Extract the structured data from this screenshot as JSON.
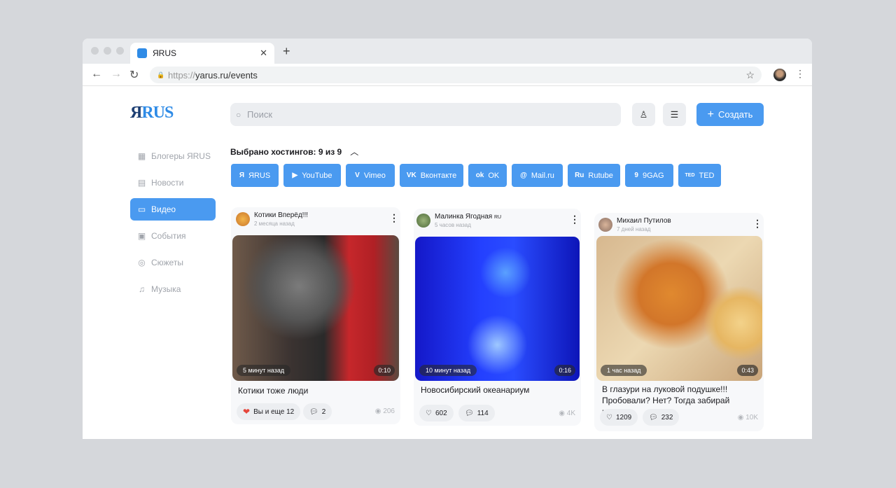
{
  "browser": {
    "tab_title": "ЯRUS",
    "url_scheme": "https://",
    "url_rest": "yarus.ru/events"
  },
  "logo": {
    "part1": "Я",
    "part2": "RUS"
  },
  "search": {
    "placeholder": "Поиск"
  },
  "header": {
    "create_label": "Создать"
  },
  "sidebar": {
    "items": [
      {
        "label": "Блогеры ЯRUS",
        "icon": "grid-icon"
      },
      {
        "label": "Новости",
        "icon": "news-icon"
      },
      {
        "label": "Видео",
        "icon": "video-icon",
        "active": true
      },
      {
        "label": "События",
        "icon": "calendar-icon"
      },
      {
        "label": "Сюжеты",
        "icon": "play-circle-icon"
      },
      {
        "label": "Музыка",
        "icon": "music-icon"
      }
    ]
  },
  "hosts": {
    "title": "Выбрано хостингов: 9 из 9",
    "chips": [
      {
        "label": "ЯRUS",
        "icon": "Я"
      },
      {
        "label": "YouTube",
        "icon": "▶"
      },
      {
        "label": "Vimeo",
        "icon": "V"
      },
      {
        "label": "Вконтакте",
        "icon": "VK"
      },
      {
        "label": "OK",
        "icon": "ok"
      },
      {
        "label": "Mail.ru",
        "icon": "@"
      },
      {
        "label": "Rutube",
        "icon": "Ru"
      },
      {
        "label": "9GAG",
        "icon": "9"
      },
      {
        "label": "TED",
        "icon": "TED"
      }
    ]
  },
  "accent": "#4a9af0",
  "cards": [
    {
      "author": "Котики Вперёд!!!",
      "time": "2 месяца назад",
      "badge": "5 минут назад",
      "duration": "0:10",
      "title": "Котики тоже люди",
      "likes": "Вы и еще 12",
      "comments": "2",
      "views": "206"
    },
    {
      "author": "Малинка Ягодная",
      "author_tag": "RU",
      "time": "5 часов назад",
      "badge": "10 минут назад",
      "duration": "0:16",
      "title": "Новосибирский океанариум",
      "likes": "602",
      "comments": "114",
      "views": "4K"
    },
    {
      "author": "Михаил Путилов",
      "time": "7 дней назад",
      "badge": "1 час назад",
      "duration": "0:43",
      "title": "В глазури на луковой подушке!!! Пробовали? Нет? Тогда забирай рецеп...",
      "likes": "1209",
      "comments": "232",
      "views": "10K"
    }
  ]
}
